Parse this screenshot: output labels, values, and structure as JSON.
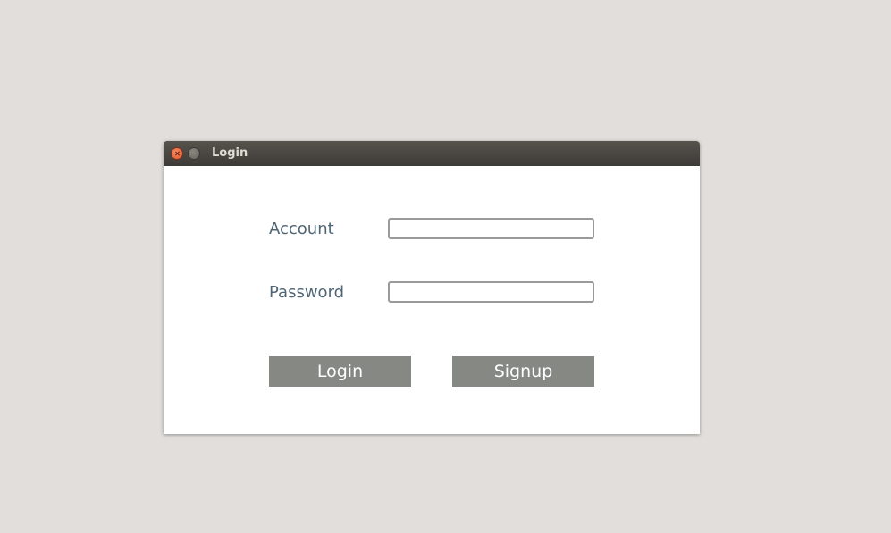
{
  "window": {
    "title": "Login"
  },
  "form": {
    "account_label": "Account",
    "account_value": "",
    "password_label": "Password",
    "password_value": "",
    "login_label": "Login",
    "signup_label": "Signup"
  },
  "colors": {
    "desktop_bg": "#e1dedb",
    "titlebar": "#3d3b37",
    "label_text": "#4f6574",
    "button_bg": "#868884",
    "close_button": "#e2582f"
  }
}
